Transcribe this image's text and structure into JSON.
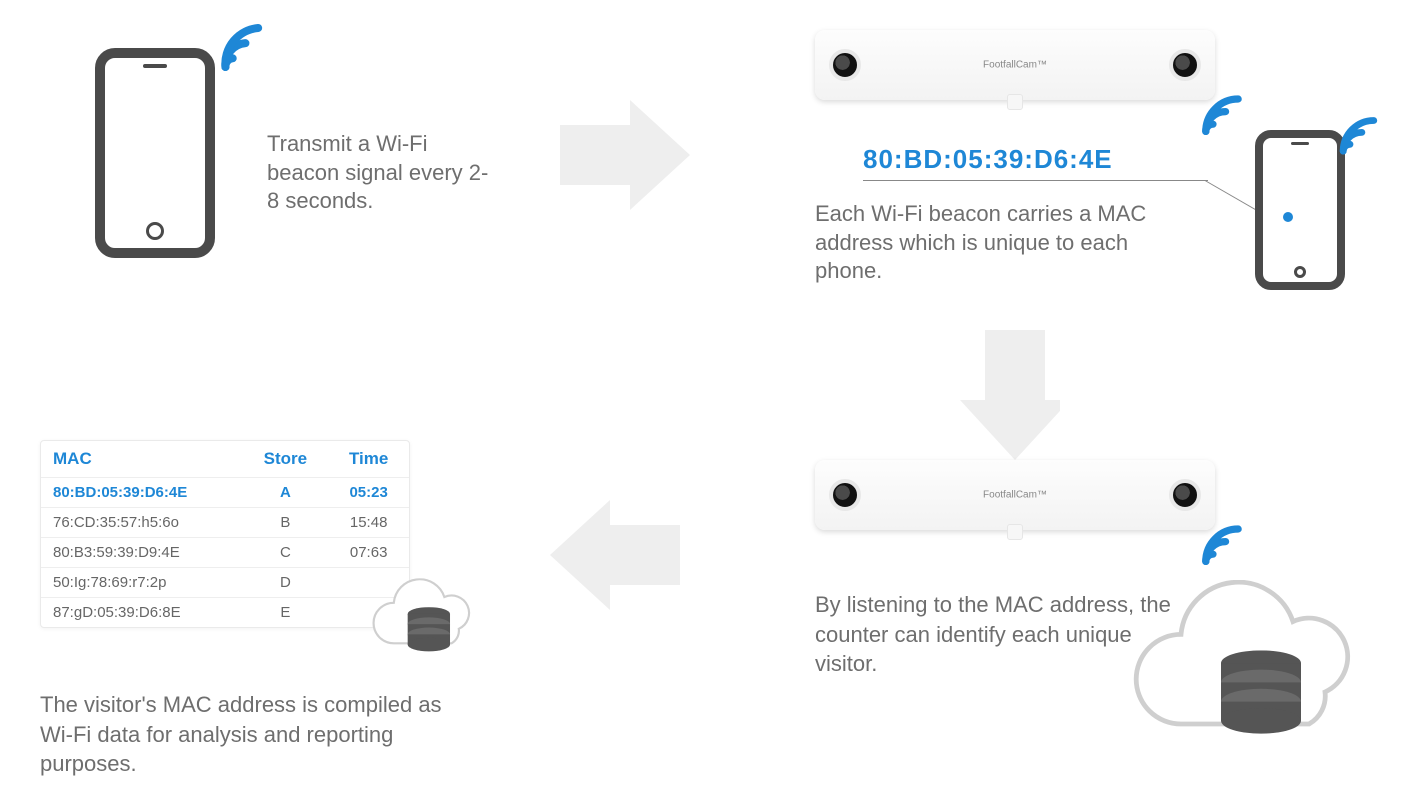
{
  "colors": {
    "accent": "#1e87d6",
    "text": "#6e6e6e",
    "device": "#4a4a4a"
  },
  "device_brand": "FootfallCam™",
  "step1": {
    "text": "Transmit a Wi-Fi beacon signal every 2-8 seconds."
  },
  "step2": {
    "mac": "80:BD:05:39:D6:4E",
    "text": "Each Wi-Fi beacon carries a MAC address which is unique to each phone."
  },
  "step3": {
    "text": "By listening to the MAC address, the counter can identify each unique visitor."
  },
  "step4": {
    "text": "The visitor's MAC address is compiled as Wi-Fi data for analysis and reporting purposes.",
    "headers": {
      "mac": "MAC",
      "store": "Store",
      "time": "Time"
    },
    "rows": [
      {
        "mac": "80:BD:05:39:D6:4E",
        "store": "A",
        "time": "05:23",
        "highlight": true
      },
      {
        "mac": "76:CD:35:57:h5:6o",
        "store": "B",
        "time": "15:48",
        "highlight": false
      },
      {
        "mac": "80:B3:59:39:D9:4E",
        "store": "C",
        "time": "07:63",
        "highlight": false
      },
      {
        "mac": "50:Ig:78:69:r7:2p",
        "store": "D",
        "time": "",
        "highlight": false
      },
      {
        "mac": "87:gD:05:39:D6:8E",
        "store": "E",
        "time": "",
        "highlight": false
      }
    ]
  },
  "icons": {
    "wifi": "wifi-icon",
    "arrow_right": "arrow-right-icon",
    "arrow_down": "arrow-down-icon",
    "arrow_left": "arrow-left-icon",
    "cloud_db": "cloud-database-icon",
    "phone": "smartphone-icon",
    "counter_device": "counter-device-icon"
  }
}
